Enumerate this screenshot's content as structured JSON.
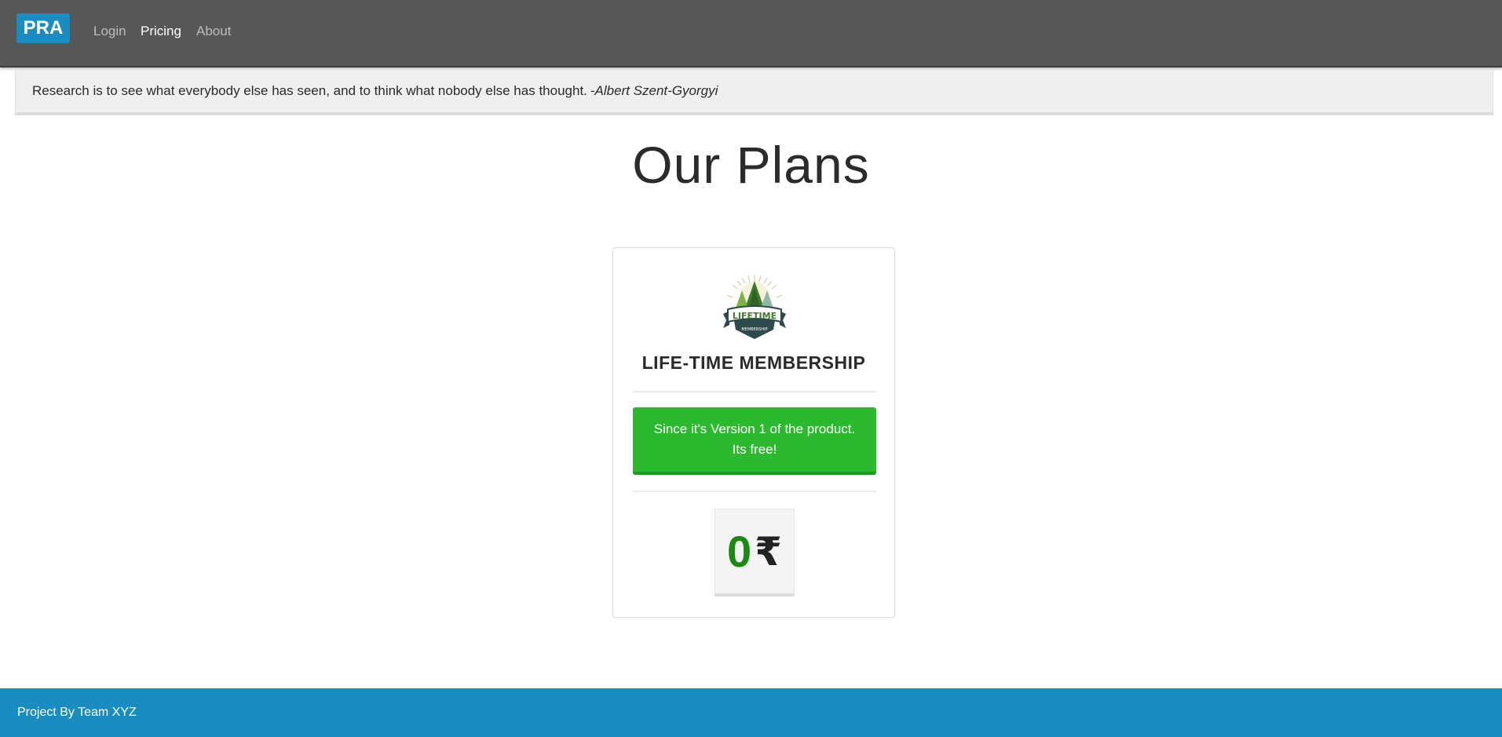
{
  "navbar": {
    "brand": "PRA",
    "links": [
      {
        "label": "Login",
        "active": false
      },
      {
        "label": "Pricing",
        "active": true
      },
      {
        "label": "About",
        "active": false
      }
    ]
  },
  "quote": {
    "text": "Research is to see what everybody else has seen, and to think what nobody else has thought.",
    "author": "-Albert Szent-Gyorgyi"
  },
  "page": {
    "title": "Our Plans"
  },
  "plan": {
    "logo": {
      "top_text": "LIFETIME",
      "bottom_text": "MEMBERSHIP",
      "icon": "lifetime-membership-badge"
    },
    "name": "LIFE-TIME MEMBERSHIP",
    "note_line1": "Since it's Version 1 of the product.",
    "note_line2": "Its free!",
    "price": "0",
    "currency": "₹"
  },
  "footer": {
    "text": "Project By Team XYZ"
  },
  "colors": {
    "navbar": "#575757",
    "accent": "#1a8dc0",
    "success": "#2cb82f",
    "price": "#1a8a12"
  }
}
